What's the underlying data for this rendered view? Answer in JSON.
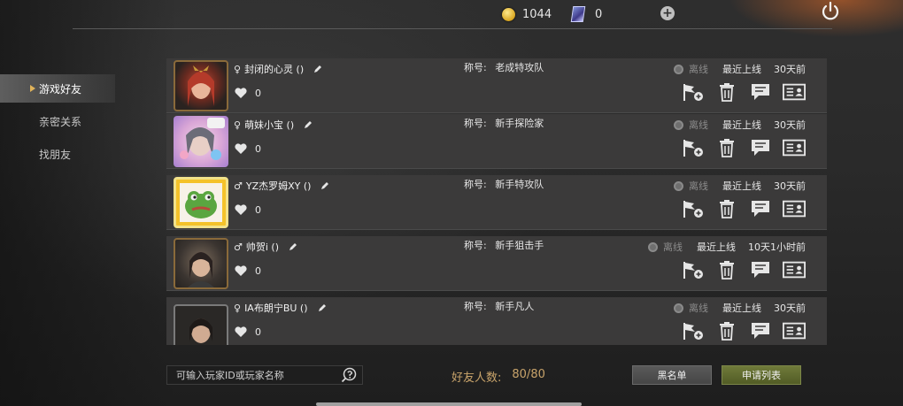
{
  "header": {
    "coins": "1044",
    "cards": "0"
  },
  "sidebar": {
    "items": [
      {
        "label": "游戏好友",
        "active": true
      },
      {
        "label": "亲密关系",
        "active": false
      },
      {
        "label": "找朋友",
        "active": false
      }
    ]
  },
  "friends": [
    {
      "gender": "♀",
      "name": "封闭的心灵 ()",
      "hearts": "0",
      "title_label": "称号:",
      "title": "老成特攻队",
      "status": "离线",
      "last_online_label": "最近上线",
      "last_online": "30天前"
    },
    {
      "gender": "♀",
      "name": "萌妹小宝 ()",
      "hearts": "0",
      "title_label": "称号:",
      "title": "新手探险家",
      "status": "离线",
      "last_online_label": "最近上线",
      "last_online": "30天前"
    },
    {
      "gender": "♂",
      "name": "YZ杰罗姆XY ()",
      "hearts": "0",
      "title_label": "称号:",
      "title": "新手特攻队",
      "status": "离线",
      "last_online_label": "最近上线",
      "last_online": "30天前"
    },
    {
      "gender": "♂",
      "name": "帅贺i ()",
      "hearts": "0",
      "title_label": "称号:",
      "title": "新手狙击手",
      "status": "离线",
      "last_online_label": "最近上线",
      "last_online": "10天1小时前"
    },
    {
      "gender": "♀",
      "name": "IA布朗宁BU ()",
      "hearts": "0",
      "title_label": "称号:",
      "title": "新手凡人",
      "status": "离线",
      "last_online_label": "最近上线",
      "last_online": "30天前"
    }
  ],
  "footer": {
    "search_placeholder": "可输入玩家ID或玩家名称",
    "friend_count_label": "好友人数:",
    "friend_count_value": "80/80",
    "blacklist_label": "黑名单",
    "apply_list_label": "申请列表"
  },
  "colors": {
    "accent_gold": "#c9a46b",
    "apply_green": "#5f6a2f",
    "row_bg": "#3b3a3a"
  }
}
